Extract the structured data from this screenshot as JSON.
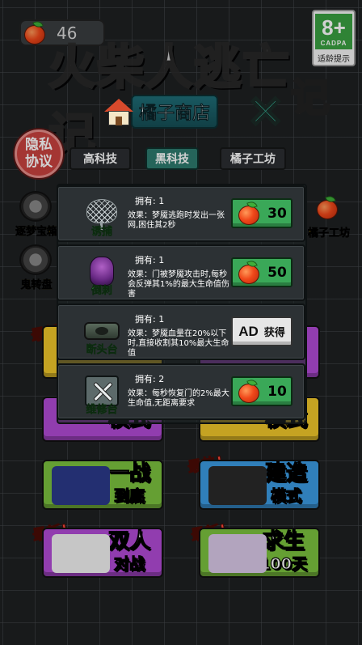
{
  "header": {
    "fruit_count": "46",
    "age_rating": {
      "label": "8+",
      "org": "CADPA",
      "tip": "适龄提示"
    },
    "game_logo": "火柴人逃亡记",
    "shop_title": "橘子商店"
  },
  "privacy_button": "隐私\n协议",
  "tabs": [
    {
      "label": "高科技",
      "active": false
    },
    {
      "label": "黑科技",
      "active": true
    },
    {
      "label": "橘子工坊",
      "active": false
    }
  ],
  "side_items": [
    {
      "label": "逐梦宝箱"
    },
    {
      "label": "鬼转盘"
    },
    {
      "label": "橘子工坊"
    }
  ],
  "modes": [
    {
      "label": "一战",
      "sub": "到底",
      "tag": ""
    },
    {
      "label": "建造",
      "sub": "模式",
      "tag": "最热!"
    },
    {
      "label": "双人",
      "sub": "对战",
      "tag": "最新!"
    },
    {
      "label": "求生",
      "sub": "100天",
      "tag": "最新!"
    },
    {
      "label": "模式",
      "sub": "",
      "tag": ""
    },
    {
      "label": "模式",
      "sub": "",
      "tag": ""
    }
  ],
  "new_tag_partial": "最新",
  "shop_items": [
    {
      "name": "诱捕",
      "icon": "net-icon",
      "owned": "拥有: 1",
      "desc": "效果：梦魇逃跑时发出一张网,困住其2秒",
      "price": "30",
      "kind": "fruit"
    },
    {
      "name": "倒刺",
      "icon": "tentacle-icon",
      "owned": "拥有: 1",
      "desc": "效果：门被梦魇攻击时,每秒会反弹其1%的最大生命值伤害",
      "price": "50",
      "kind": "fruit"
    },
    {
      "name": "断头台",
      "icon": "guillotine-icon",
      "owned": "拥有: 1",
      "desc": "效果：梦魇血量在20%以下时,直接收割其10%最大生命值",
      "ad_label": "AD",
      "ad_action": "获得",
      "kind": "ad"
    },
    {
      "name": "维修台",
      "icon": "repair-station-icon",
      "owned": "拥有: 2",
      "desc": "效果：每秒恢复门的2%最大生命值,无距离要求",
      "price": "10",
      "kind": "fruit"
    }
  ]
}
